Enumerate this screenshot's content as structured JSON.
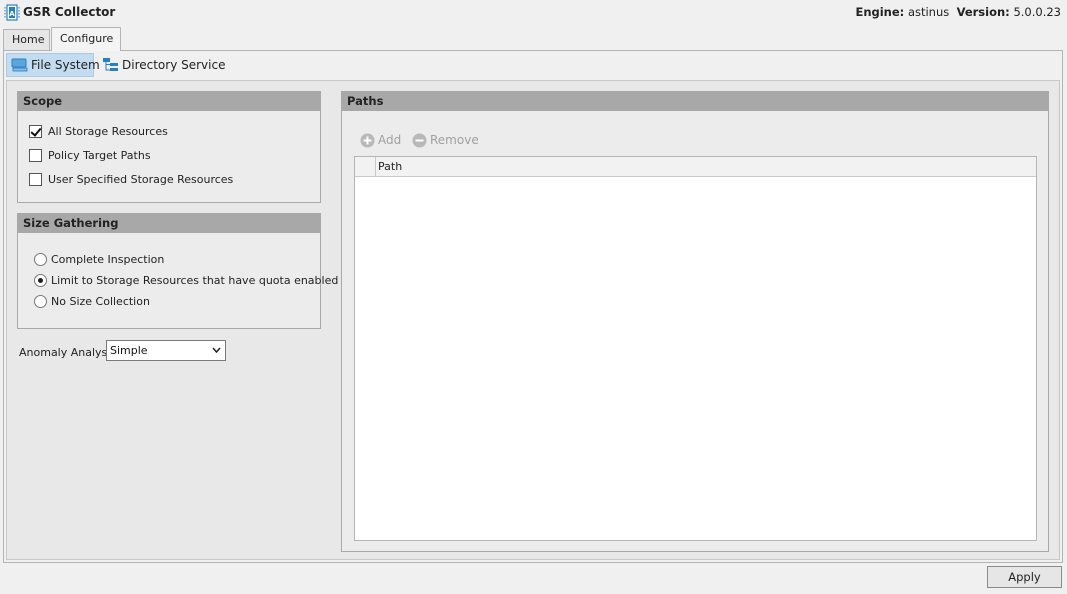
{
  "app": {
    "title": "GSR Collector",
    "engine_label": "Engine:",
    "engine_value": "astinus",
    "version_label": "Version:",
    "version_value": "5.0.0.23"
  },
  "tabs": [
    {
      "label": "Home",
      "active": false
    },
    {
      "label": "Configure",
      "active": true
    }
  ],
  "subnav": [
    {
      "label": "File System",
      "icon": "file-system-icon",
      "selected": true
    },
    {
      "label": "Directory Service",
      "icon": "directory-service-icon",
      "selected": false
    }
  ],
  "scope": {
    "title": "Scope",
    "options": [
      {
        "label": "All Storage Resources",
        "checked": true
      },
      {
        "label": "Policy Target Paths",
        "checked": false
      },
      {
        "label": "User Specified Storage Resources",
        "checked": false
      }
    ]
  },
  "size_gathering": {
    "title": "Size Gathering",
    "options": [
      {
        "label": "Complete Inspection",
        "selected": false
      },
      {
        "label": "Limit to Storage Resources that have quota enabled",
        "selected": true
      },
      {
        "label": "No Size Collection",
        "selected": false
      }
    ]
  },
  "anomaly": {
    "label": "Anomaly Analysis",
    "value": "Simple"
  },
  "paths": {
    "title": "Paths",
    "add_label": "Add",
    "remove_label": "Remove",
    "column_header": "Path",
    "rows": []
  },
  "footer": {
    "apply_label": "Apply"
  },
  "colors": {
    "group_header": "#a8a8a8",
    "selected_nav": "#c3dcf0",
    "disabled_text": "#a0a0a0"
  }
}
